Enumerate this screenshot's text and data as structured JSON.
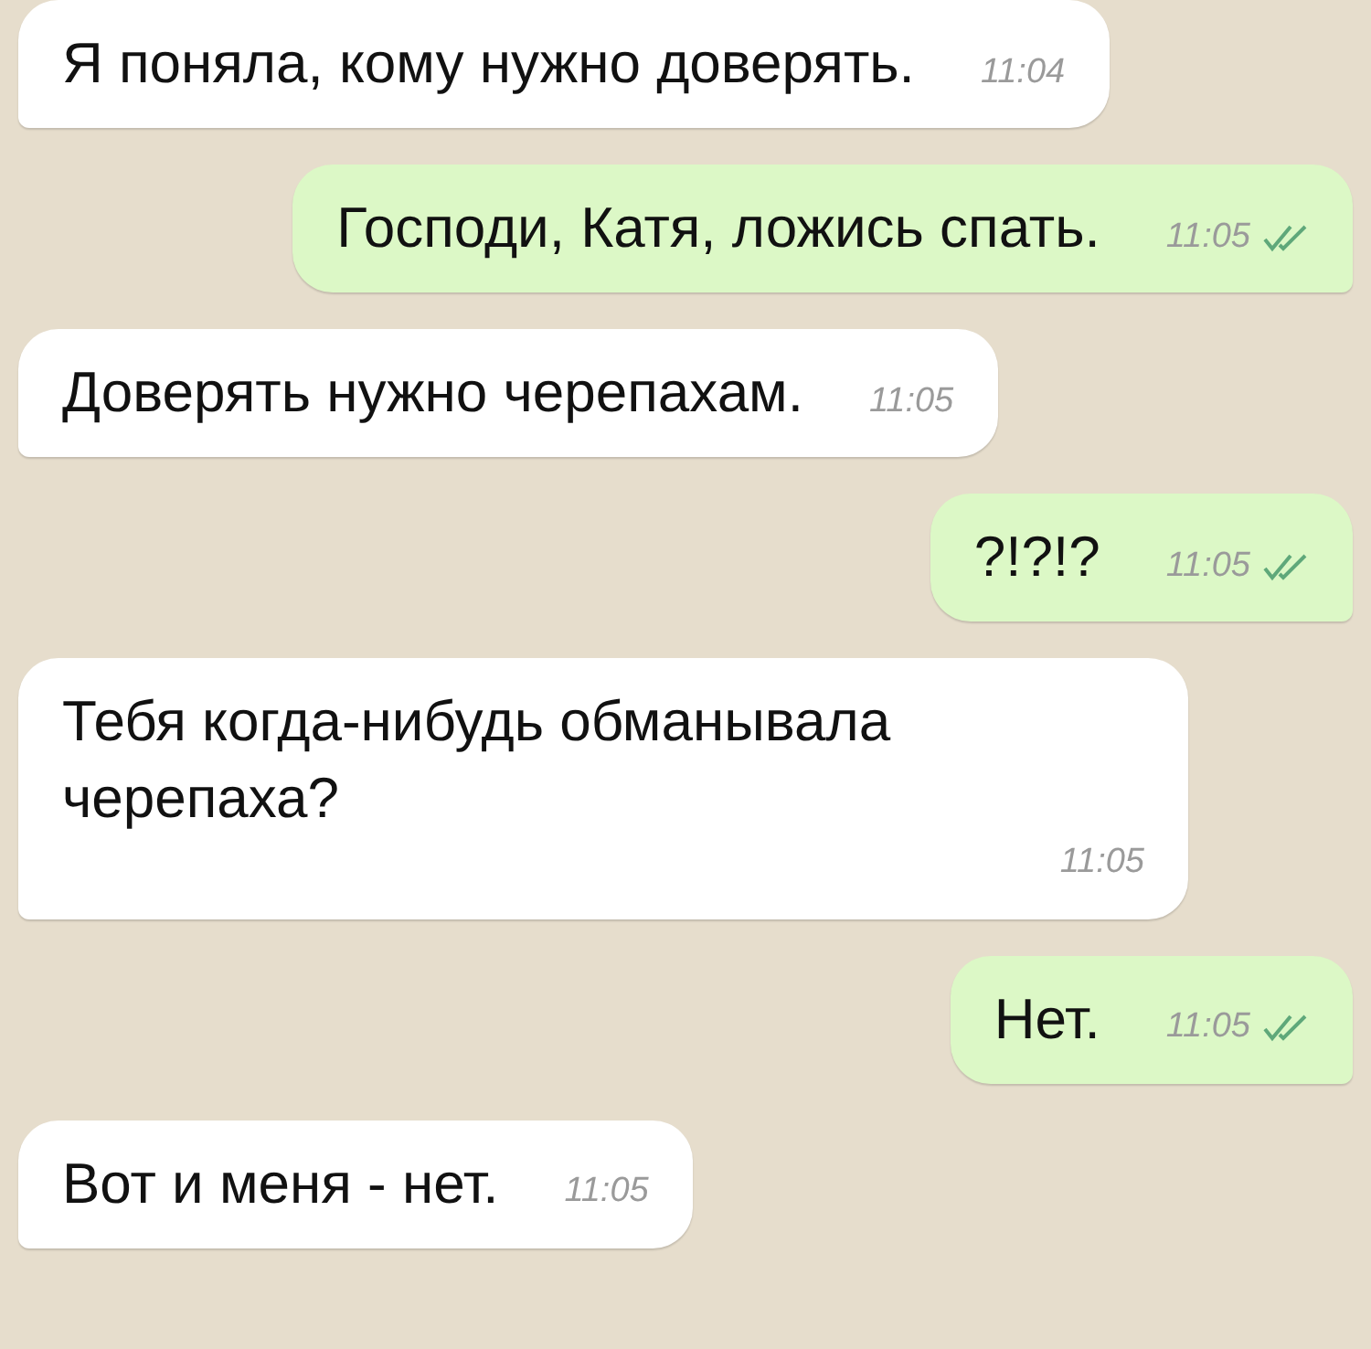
{
  "messages": [
    {
      "kind": "incoming",
      "text": "Я поняла, кому нужно доверять.",
      "time": "11:04"
    },
    {
      "kind": "outgoing",
      "text": "Господи, Катя, ложись спать.",
      "time": "11:05",
      "read": true
    },
    {
      "kind": "incoming",
      "text": "Доверять нужно черепахам.",
      "time": "11:05"
    },
    {
      "kind": "outgoing",
      "text": "?!?!?",
      "time": "11:05",
      "read": true
    },
    {
      "kind": "incoming",
      "text": "Тебя когда-нибудь обманывала черепаха?",
      "time": "11:05"
    },
    {
      "kind": "outgoing",
      "text": "Нет.",
      "time": "11:05",
      "read": true
    },
    {
      "kind": "incoming",
      "text": "Вот и меня - нет.",
      "time": "11:05"
    }
  ]
}
